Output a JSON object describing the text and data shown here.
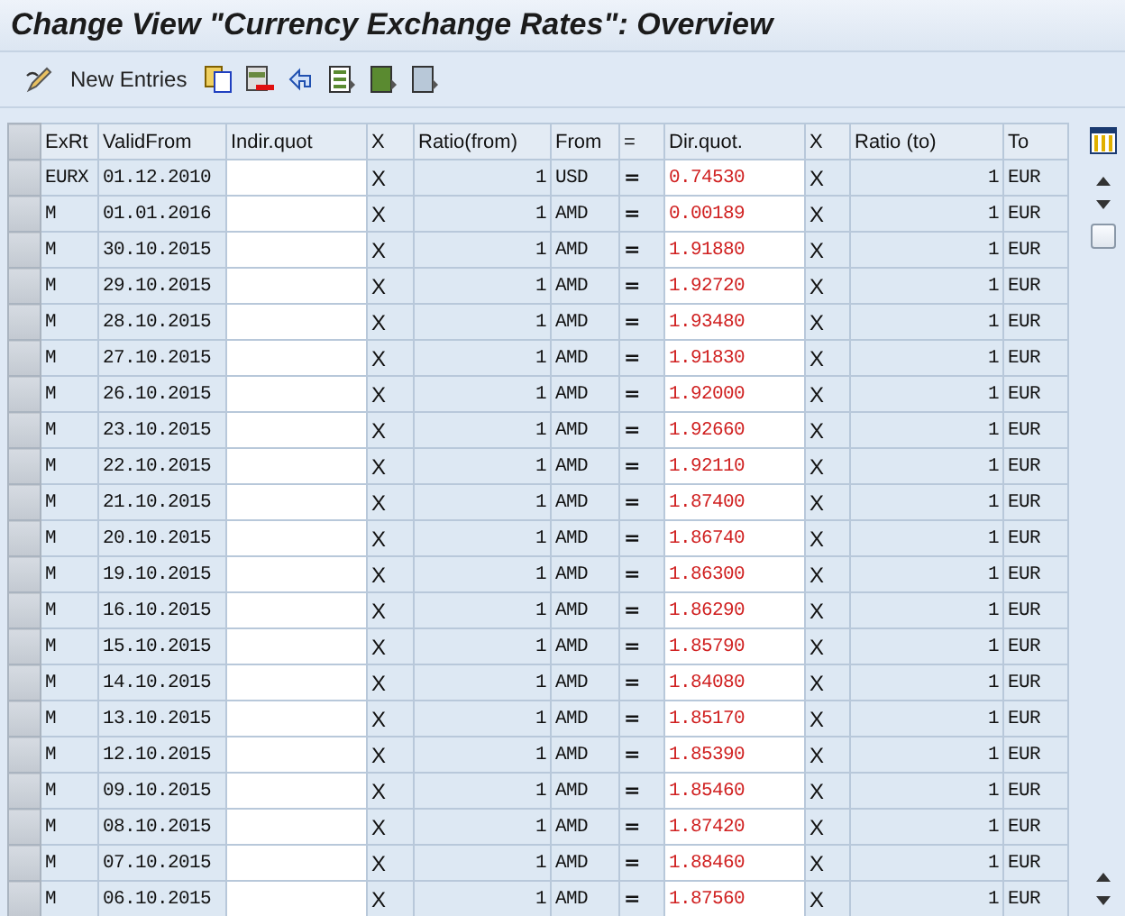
{
  "window": {
    "title": "Change View \"Currency Exchange Rates\": Overview"
  },
  "toolbar": {
    "new_entries": "New Entries"
  },
  "table": {
    "columns": [
      "ExRt",
      "ValidFrom",
      "Indir.quot",
      "X",
      "Ratio(from)",
      "From",
      "=",
      "Dir.quot.",
      "X",
      "Ratio (to)",
      "To"
    ],
    "rows": [
      {
        "exrt": "EURX",
        "valid_from": "01.12.2010",
        "x1": "X",
        "ratio_from": "1",
        "from": "USD",
        "eq": "=",
        "dir": "0.74530",
        "x2": "X",
        "ratio_to": "1",
        "to": "EUR"
      },
      {
        "exrt": "M",
        "valid_from": "01.01.2016",
        "x1": "X",
        "ratio_from": "1",
        "from": "AMD",
        "eq": "=",
        "dir": "0.00189",
        "x2": "X",
        "ratio_to": "1",
        "to": "EUR"
      },
      {
        "exrt": "M",
        "valid_from": "30.10.2015",
        "x1": "X",
        "ratio_from": "1",
        "from": "AMD",
        "eq": "=",
        "dir": "1.91880",
        "x2": "X",
        "ratio_to": "1",
        "to": "EUR"
      },
      {
        "exrt": "M",
        "valid_from": "29.10.2015",
        "x1": "X",
        "ratio_from": "1",
        "from": "AMD",
        "eq": "=",
        "dir": "1.92720",
        "x2": "X",
        "ratio_to": "1",
        "to": "EUR"
      },
      {
        "exrt": "M",
        "valid_from": "28.10.2015",
        "x1": "X",
        "ratio_from": "1",
        "from": "AMD",
        "eq": "=",
        "dir": "1.93480",
        "x2": "X",
        "ratio_to": "1",
        "to": "EUR"
      },
      {
        "exrt": "M",
        "valid_from": "27.10.2015",
        "x1": "X",
        "ratio_from": "1",
        "from": "AMD",
        "eq": "=",
        "dir": "1.91830",
        "x2": "X",
        "ratio_to": "1",
        "to": "EUR"
      },
      {
        "exrt": "M",
        "valid_from": "26.10.2015",
        "x1": "X",
        "ratio_from": "1",
        "from": "AMD",
        "eq": "=",
        "dir": "1.92000",
        "x2": "X",
        "ratio_to": "1",
        "to": "EUR"
      },
      {
        "exrt": "M",
        "valid_from": "23.10.2015",
        "x1": "X",
        "ratio_from": "1",
        "from": "AMD",
        "eq": "=",
        "dir": "1.92660",
        "x2": "X",
        "ratio_to": "1",
        "to": "EUR"
      },
      {
        "exrt": "M",
        "valid_from": "22.10.2015",
        "x1": "X",
        "ratio_from": "1",
        "from": "AMD",
        "eq": "=",
        "dir": "1.92110",
        "x2": "X",
        "ratio_to": "1",
        "to": "EUR"
      },
      {
        "exrt": "M",
        "valid_from": "21.10.2015",
        "x1": "X",
        "ratio_from": "1",
        "from": "AMD",
        "eq": "=",
        "dir": "1.87400",
        "x2": "X",
        "ratio_to": "1",
        "to": "EUR"
      },
      {
        "exrt": "M",
        "valid_from": "20.10.2015",
        "x1": "X",
        "ratio_from": "1",
        "from": "AMD",
        "eq": "=",
        "dir": "1.86740",
        "x2": "X",
        "ratio_to": "1",
        "to": "EUR"
      },
      {
        "exrt": "M",
        "valid_from": "19.10.2015",
        "x1": "X",
        "ratio_from": "1",
        "from": "AMD",
        "eq": "=",
        "dir": "1.86300",
        "x2": "X",
        "ratio_to": "1",
        "to": "EUR"
      },
      {
        "exrt": "M",
        "valid_from": "16.10.2015",
        "x1": "X",
        "ratio_from": "1",
        "from": "AMD",
        "eq": "=",
        "dir": "1.86290",
        "x2": "X",
        "ratio_to": "1",
        "to": "EUR"
      },
      {
        "exrt": "M",
        "valid_from": "15.10.2015",
        "x1": "X",
        "ratio_from": "1",
        "from": "AMD",
        "eq": "=",
        "dir": "1.85790",
        "x2": "X",
        "ratio_to": "1",
        "to": "EUR"
      },
      {
        "exrt": "M",
        "valid_from": "14.10.2015",
        "x1": "X",
        "ratio_from": "1",
        "from": "AMD",
        "eq": "=",
        "dir": "1.84080",
        "x2": "X",
        "ratio_to": "1",
        "to": "EUR"
      },
      {
        "exrt": "M",
        "valid_from": "13.10.2015",
        "x1": "X",
        "ratio_from": "1",
        "from": "AMD",
        "eq": "=",
        "dir": "1.85170",
        "x2": "X",
        "ratio_to": "1",
        "to": "EUR"
      },
      {
        "exrt": "M",
        "valid_from": "12.10.2015",
        "x1": "X",
        "ratio_from": "1",
        "from": "AMD",
        "eq": "=",
        "dir": "1.85390",
        "x2": "X",
        "ratio_to": "1",
        "to": "EUR"
      },
      {
        "exrt": "M",
        "valid_from": "09.10.2015",
        "x1": "X",
        "ratio_from": "1",
        "from": "AMD",
        "eq": "=",
        "dir": "1.85460",
        "x2": "X",
        "ratio_to": "1",
        "to": "EUR"
      },
      {
        "exrt": "M",
        "valid_from": "08.10.2015",
        "x1": "X",
        "ratio_from": "1",
        "from": "AMD",
        "eq": "=",
        "dir": "1.87420",
        "x2": "X",
        "ratio_to": "1",
        "to": "EUR"
      },
      {
        "exrt": "M",
        "valid_from": "07.10.2015",
        "x1": "X",
        "ratio_from": "1",
        "from": "AMD",
        "eq": "=",
        "dir": "1.88460",
        "x2": "X",
        "ratio_to": "1",
        "to": "EUR"
      },
      {
        "exrt": "M",
        "valid_from": "06.10.2015",
        "x1": "X",
        "ratio_from": "1",
        "from": "AMD",
        "eq": "=",
        "dir": "1.87560",
        "x2": "X",
        "ratio_to": "1",
        "to": "EUR"
      }
    ]
  }
}
